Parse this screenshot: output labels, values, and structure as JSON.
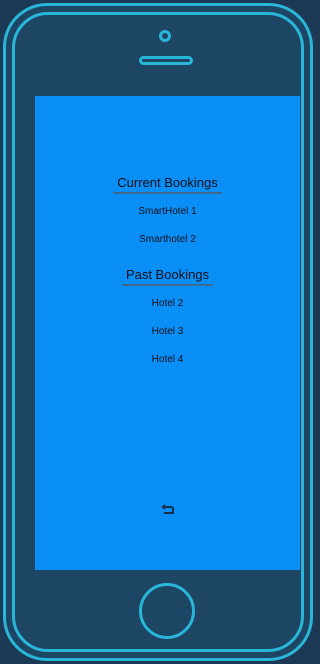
{
  "app": {
    "current_heading": "Current Bookings",
    "current_items": [
      "SmartHotel 1",
      "Smarthotel 2"
    ],
    "past_heading": "Past Bookings",
    "past_items": [
      "Hotel 2",
      "Hotel 3",
      "Hotel 4"
    ]
  },
  "icons": {
    "back": "return-arrow-icon"
  },
  "colors": {
    "screen": "#0a8ff7",
    "frame": "#29b6d8",
    "device_body": "#1c4664",
    "text": "#0a0f18"
  }
}
